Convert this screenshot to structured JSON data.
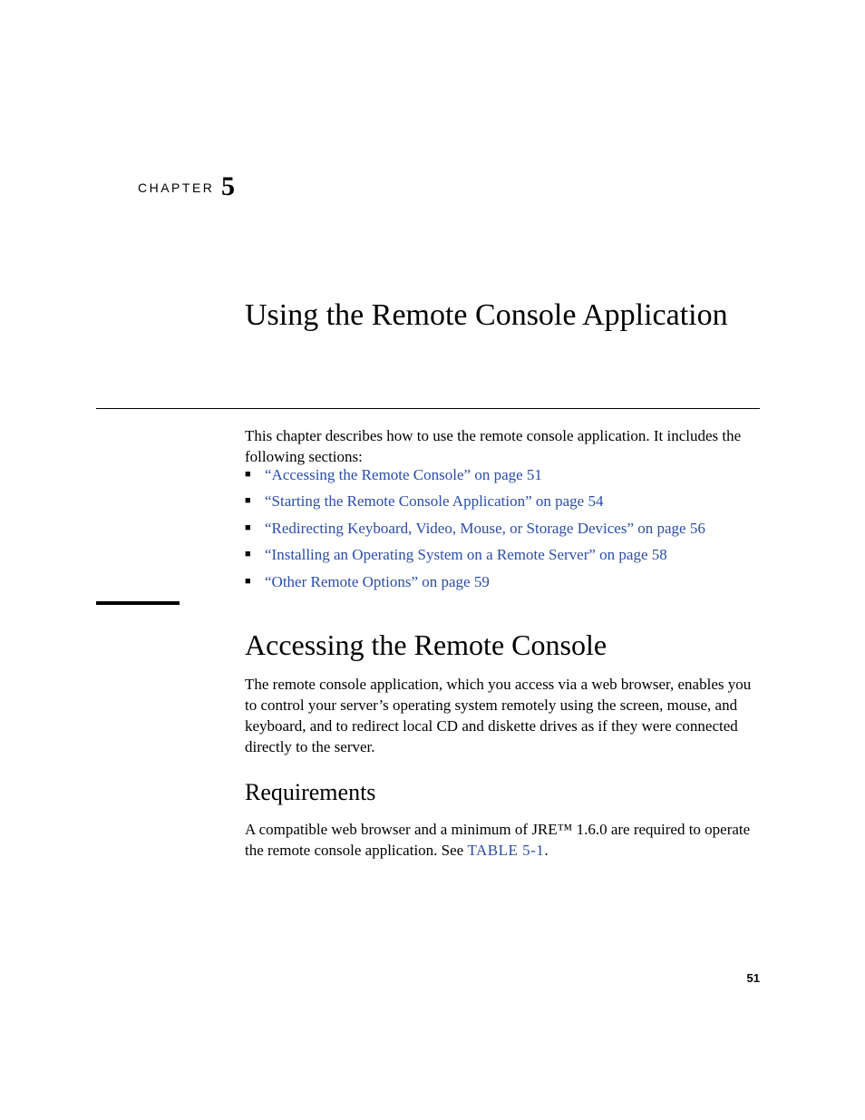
{
  "chapter": {
    "label": "CHAPTER",
    "number": "5",
    "title": "Using the Remote Console Application"
  },
  "intro": "This chapter describes how to use the remote console application. It includes the following sections:",
  "toc": [
    "“Accessing the Remote Console” on page 51",
    "“Starting the Remote Console Application” on page 54",
    "“Redirecting Keyboard, Video, Mouse, or Storage Devices” on page 56",
    "“Installing an Operating System on a Remote Server” on page 58",
    "“Other Remote Options” on page 59"
  ],
  "section": {
    "title": "Accessing the Remote Console",
    "body": "The remote console application, which you access via a web browser, enables you to control your server’s operating system remotely using the screen, mouse, and keyboard, and to redirect local CD and diskette drives as if they were connected directly to the server."
  },
  "subsection": {
    "title": "Requirements",
    "body_pre": "A compatible web browser and a minimum of JRE™ 1.6.0 are required to operate the remote console application. See ",
    "table_ref": "TABLE 5-1",
    "body_post": "."
  },
  "page_number": "51"
}
